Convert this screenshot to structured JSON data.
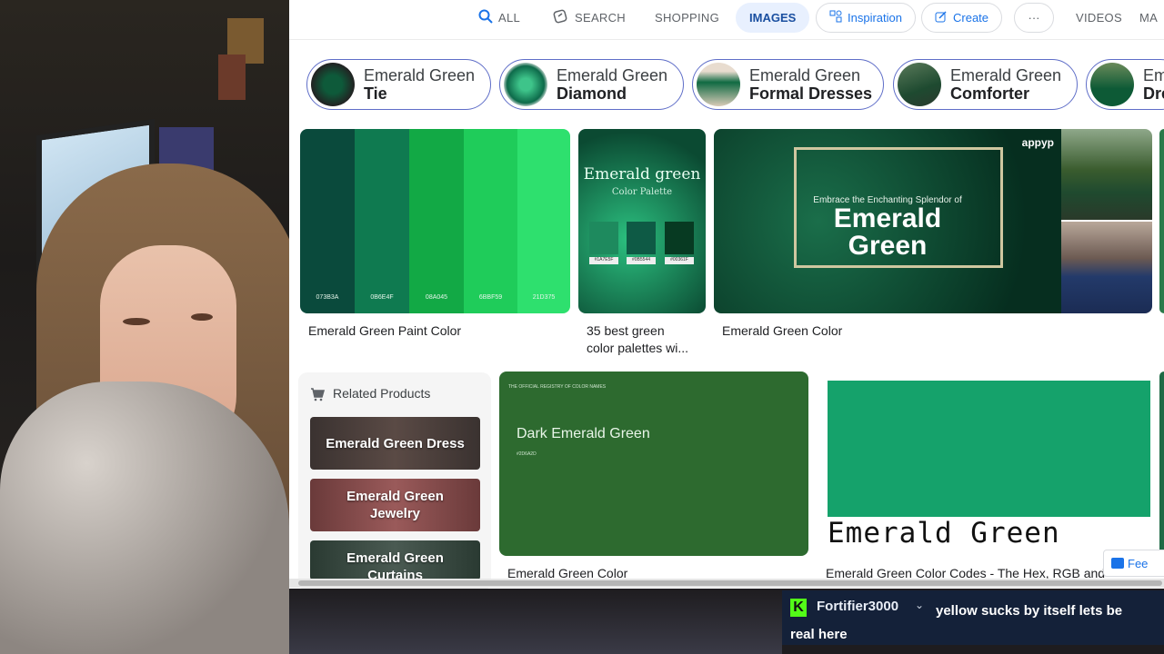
{
  "nav": {
    "all": "ALL",
    "search": "SEARCH",
    "shopping": "SHOPPING",
    "images": "IMAGES",
    "inspiration": "Inspiration",
    "create": "Create",
    "more": "···",
    "videos": "VIDEOS",
    "maps": "MA"
  },
  "chips": [
    {
      "line1": "Emerald Green",
      "line2": "Tie"
    },
    {
      "line1": "Emerald Green",
      "line2": "Diamond"
    },
    {
      "line1": "Emerald Green",
      "line2": "Formal Dresses"
    },
    {
      "line1": "Emerald Green",
      "line2": "Comforter"
    },
    {
      "line1": "Em",
      "line2": "Dre"
    }
  ],
  "results": {
    "paint": {
      "caption": "Emerald Green Paint Color",
      "swatches": [
        {
          "hex": "073B3A",
          "color": "#0a4a3c"
        },
        {
          "hex": "0B6E4F",
          "color": "#0f7a50"
        },
        {
          "hex": "08A045",
          "color": "#12a945"
        },
        {
          "hex": "6BBF59",
          "color": "#1fcc5a"
        },
        {
          "hex": "21D375",
          "color": "#2ee06e"
        }
      ]
    },
    "palettes": {
      "caption_line1": "35 best green",
      "caption_line2": "color palettes wi...",
      "title": "Emerald green",
      "subtitle": "Color Palette",
      "boxes": [
        {
          "hex": "#1A7E5F",
          "color": "#1e8a5e"
        },
        {
          "hex": "#0B5544",
          "color": "#0e5a45"
        },
        {
          "hex": "#00361F",
          "color": "#073a22"
        }
      ]
    },
    "emerald_color": {
      "caption": "Emerald Green Color",
      "small": "Embrace the Enchanting Splendor of",
      "big1": "Emerald",
      "big2": "Green",
      "logo": "appyp"
    },
    "dark_emerald": {
      "caption": "Emerald Green Color",
      "small": "THE OFFICIAL REGISTRY OF COLOR NAMES",
      "title": "Dark Emerald Green",
      "hex": "#2D6A2D"
    },
    "codes": {
      "caption": "Emerald Green Color Codes - The Hex, RGB and",
      "title": "Emerald Green"
    }
  },
  "related": {
    "title": "Related Products",
    "items": [
      {
        "line1": "Emerald Green Dress",
        "line2": ""
      },
      {
        "line1": "Emerald Green",
        "line2": "Jewelry"
      },
      {
        "line1": "Emerald Green",
        "line2": "Curtains"
      }
    ]
  },
  "feedback": "Fee",
  "chat": {
    "badge": "K",
    "username": "Fortifier3000",
    "chevron": "⌄",
    "message": "yellow sucks by itself lets be real here"
  }
}
